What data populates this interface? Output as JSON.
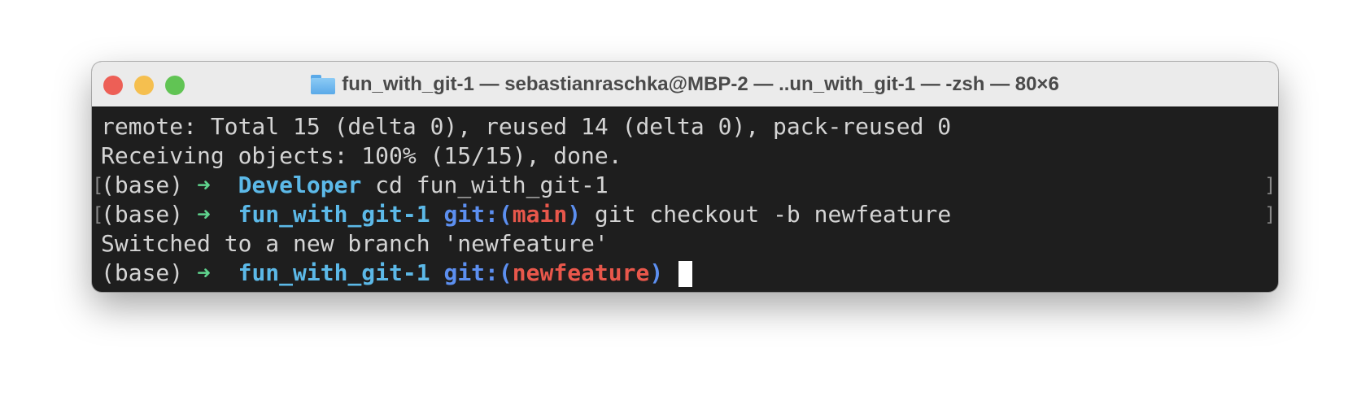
{
  "window": {
    "title": "fun_with_git-1 — sebastianraschka@MBP-2 — ..un_with_git-1 — -zsh — 80×6",
    "controls": {
      "close_color": "#ed5f56",
      "minimize_color": "#f5bf4f",
      "zoom_color": "#61c454"
    }
  },
  "terminal": {
    "line1": "remote: Total 15 (delta 0), reused 14 (delta 0), pack-reused 0",
    "line2": "Receiving objects: 100% (15/15), done.",
    "line3": {
      "env": "(base) ",
      "arrow": "➜",
      "dir": "Developer",
      "cmd": " cd fun_with_git-1"
    },
    "line4": {
      "env": "(base) ",
      "arrow": "➜",
      "dir": "fun_with_git-1",
      "git": "git:(",
      "branch": "main",
      "close": ")",
      "cmd": " git checkout -b newfeature"
    },
    "line5": "Switched to a new branch 'newfeature'",
    "line6": {
      "env": "(base) ",
      "arrow": "➜",
      "dir": "fun_with_git-1",
      "git": "git:(",
      "branch": "newfeature",
      "close": ")"
    },
    "bracket_open": "[",
    "bracket_close": "]"
  }
}
